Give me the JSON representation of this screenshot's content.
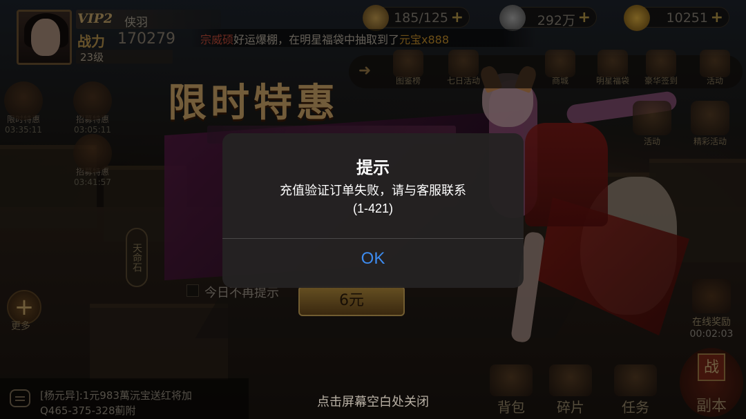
{
  "hud": {
    "vip": "VIP2",
    "player_name": "侠羽",
    "power_label": "战力",
    "power_value": "170279",
    "level": "23级"
  },
  "resources": [
    {
      "icon": "stamina-icon",
      "value": "185/125",
      "color": "#c8a050"
    },
    {
      "icon": "silver-coin-icon",
      "value": "292万",
      "color": "#9a9a9a"
    },
    {
      "icon": "gold-ingot-icon",
      "value": "10251",
      "color": "#d0a030"
    }
  ],
  "marquee": {
    "name": "宗威硕",
    "text_a": "好运爆棚，在明星福袋中抽取到了",
    "item": "元宝x888"
  },
  "top_menu": [
    {
      "label": "图鉴榜"
    },
    {
      "label": "七日活动"
    },
    {
      "label": "商城"
    },
    {
      "label": "明星福袋"
    },
    {
      "label": "豪华签到"
    },
    {
      "label": "活动"
    }
  ],
  "left_side": [
    {
      "label": "限时特惠",
      "time": "03:35:11"
    },
    {
      "label": "招募特惠",
      "time": "03:05:11"
    },
    {
      "label": "招募特惠",
      "time": "03:41:57"
    }
  ],
  "tianming": "天命石",
  "more_label": "更多",
  "right_side": [
    {
      "label": "活动"
    },
    {
      "label": "精彩活动"
    }
  ],
  "promo": {
    "title": "限时特惠",
    "checkbox_label": "今日不再提示",
    "price": "6元"
  },
  "online_reward": {
    "label": "在线奖励",
    "time": "00:02:03"
  },
  "chat": {
    "line1": "[杨元异]:1元983萬沅宝送红将加",
    "line2": "Q465-375-328薊附"
  },
  "tap_hint": "点击屏幕空白处关闭",
  "bottom_menu": [
    {
      "label": "背包"
    },
    {
      "label": "碎片"
    },
    {
      "label": "任务"
    }
  ],
  "fuben": {
    "badge": "战",
    "label": "副本"
  },
  "alert": {
    "title": "提示",
    "message": "充值验证订单失败，请与客服联系",
    "code": "(1-421)",
    "ok_label": "OK"
  },
  "colors": {
    "alert_bg": "#242222",
    "ok_blue": "#3d8cf0",
    "gold_accent": "#c6a66a"
  }
}
